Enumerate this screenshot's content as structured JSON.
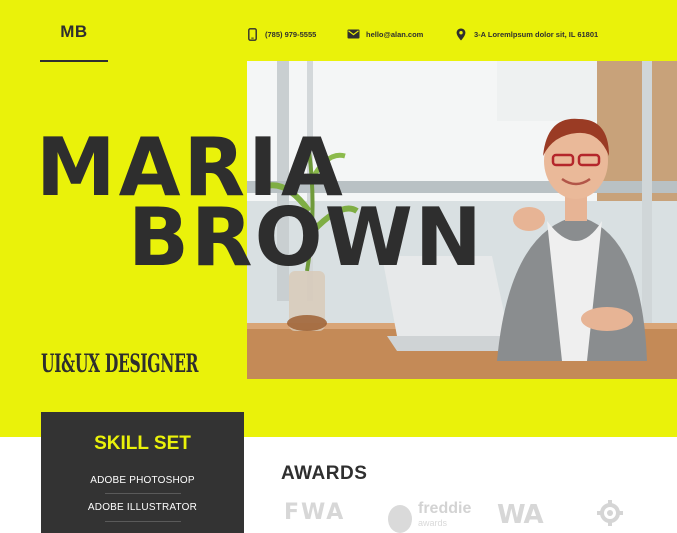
{
  "colors": {
    "accent": "#eaf20a",
    "dark": "#333333",
    "text": "#2f2f2f"
  },
  "header": {
    "logo": "MB",
    "phone": {
      "icon": "phone-icon",
      "text": "(785) 979-5555"
    },
    "email": {
      "icon": "mail-icon",
      "text": "hello@alan.com"
    },
    "address": {
      "icon": "location-pin-icon",
      "text": "3-A Loremlpsum dolor sit, IL 61801"
    }
  },
  "hero": {
    "first_name": "MARIA",
    "last_name": "BROWN",
    "role": "UI&UX DESIGNER"
  },
  "skills": {
    "title": "SKILL SET",
    "items": [
      "ADOBE PHOTOSHOP",
      "ADOBE ILLUSTRATOR"
    ]
  },
  "awards": {
    "title": "AWARDS",
    "logos": [
      {
        "name": "fwa-logo",
        "text": "FWA"
      },
      {
        "name": "freddie-awards-logo",
        "text": "freddie",
        "sub": "awards"
      },
      {
        "name": "wa-logo",
        "text": "WA"
      },
      {
        "name": "gear-award-logo",
        "text": ""
      }
    ]
  }
}
